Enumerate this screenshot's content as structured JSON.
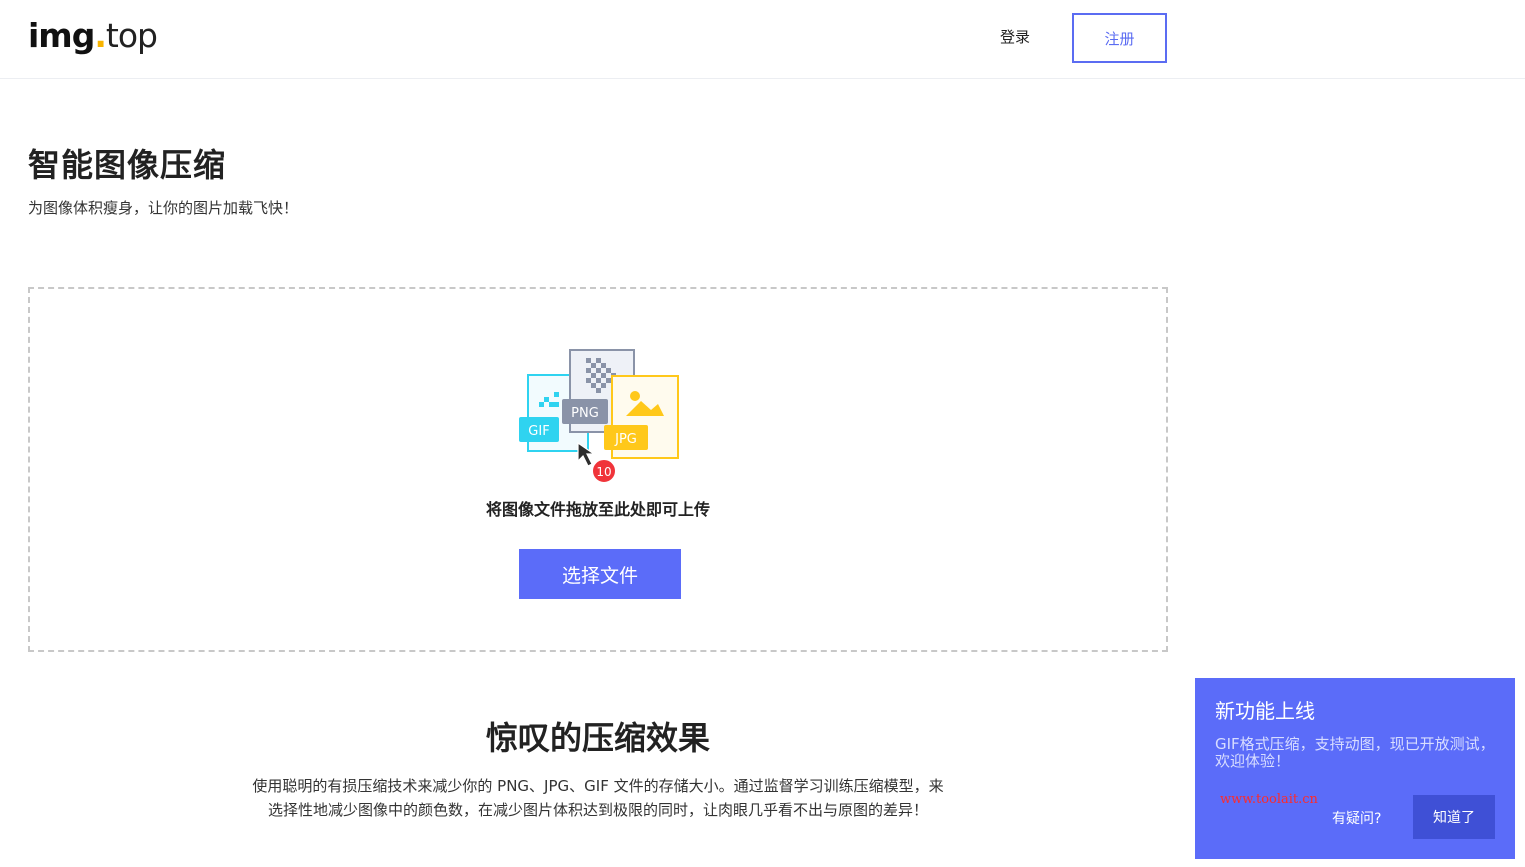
{
  "header": {
    "logo": {
      "main": "img",
      "dot": ".",
      "tld": "top"
    },
    "login_label": "登录",
    "register_label": "注册"
  },
  "hero": {
    "title": "智能图像压缩",
    "subtitle": "为图像体积瘦身，让你的图片加载飞快！"
  },
  "dropzone": {
    "file_types": [
      "GIF",
      "PNG",
      "JPG"
    ],
    "file_count_badge": "10",
    "hint": "将图像文件拖放至此处即可上传",
    "choose_button_label": "选择文件"
  },
  "section": {
    "title": "惊叹的压缩效果",
    "text_line1": "使用聪明的有损压缩技术来减少你的 PNG、JPG、GIF 文件的存储大小。通过监督学习训练压缩模型，来",
    "text_line2": "选择性地减少图像中的颜色数，在减少图片体积达到极限的同时，让肉眼几乎看不出与原图的差异！"
  },
  "notice": {
    "title": "新功能上线",
    "body": "GIF格式压缩，支持动图，现已开放测试，欢迎体验！",
    "watermark": "www.toolait.cn",
    "help_label": "有疑问?",
    "ok_label": "知道了"
  },
  "colors": {
    "accent": "#5b6cf9",
    "notice_button": "#3f50d6",
    "gif": "#2fd3f0",
    "png": "#8a93a8",
    "jpg": "#ffc81a",
    "badge": "#f0343a"
  },
  "icons": [
    "gif-file-icon",
    "png-file-icon",
    "jpg-file-icon",
    "cursor-icon",
    "count-badge"
  ]
}
